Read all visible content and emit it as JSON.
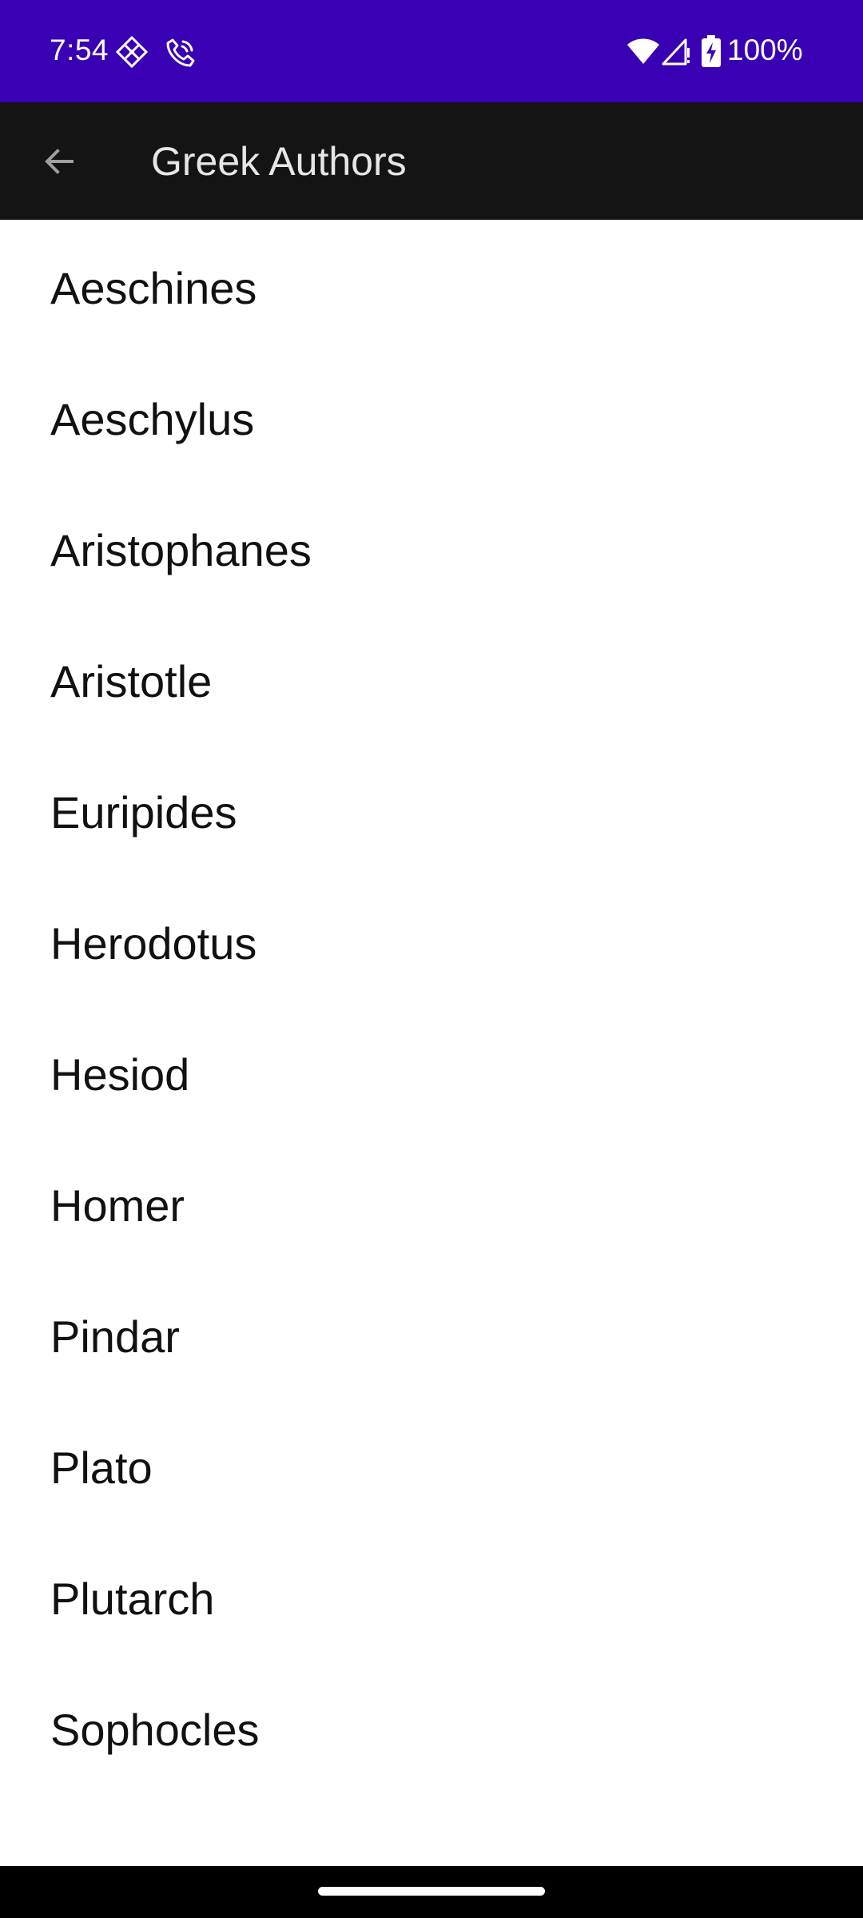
{
  "status_bar": {
    "time": "7:54",
    "battery_percent": "100%",
    "background": "#3a00b4",
    "icons": [
      "diamond-grid-icon",
      "phone-call-icon",
      "wifi-icon",
      "cell-signal-icon",
      "battery-charging-icon"
    ]
  },
  "app_bar": {
    "title": "Greek Authors",
    "back_icon": "arrow-left-icon",
    "background": "#141414"
  },
  "authors": [
    {
      "name": "Aeschines"
    },
    {
      "name": "Aeschylus"
    },
    {
      "name": "Aristophanes"
    },
    {
      "name": "Aristotle"
    },
    {
      "name": "Euripides"
    },
    {
      "name": "Herodotus"
    },
    {
      "name": "Hesiod"
    },
    {
      "name": "Homer"
    },
    {
      "name": "Pindar"
    },
    {
      "name": "Plato"
    },
    {
      "name": "Plutarch"
    },
    {
      "name": "Sophocles"
    }
  ],
  "nav_bar": {
    "background": "#000000",
    "handle": "home-gesture-handle"
  }
}
